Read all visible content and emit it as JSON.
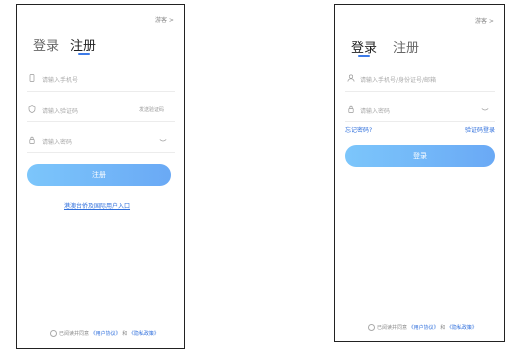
{
  "register_screen": {
    "guest_link": "游客 >",
    "tab_login": "登录",
    "tab_register": "注册",
    "phone_placeholder": "请输入手机号",
    "code_placeholder": "请输入验证码",
    "get_code_label": "发送验证码",
    "password_placeholder": "请输入密码",
    "submit_label": "注册",
    "hmt_link": "港澳台侨及国际用户入口",
    "agree_prefix": "已阅读并同意",
    "user_agreement": "《用户协议》",
    "agree_and": "和",
    "privacy_policy": "《隐私政策》"
  },
  "login_screen": {
    "guest_link": "游客 >",
    "tab_login": "登录",
    "tab_register": "注册",
    "account_placeholder": "请输入手机号/身份证号/邮箱",
    "password_placeholder": "请输入密码",
    "forgot_password": "忘记密码?",
    "sms_login": "验证码登录",
    "submit_label": "登录",
    "agree_prefix": "已阅读并同意",
    "user_agreement": "《用户协议》",
    "agree_and": "和",
    "privacy_policy": "《隐私政策》"
  },
  "icons": [
    "phone-icon",
    "shield-icon",
    "lock-icon",
    "eye-closed-icon",
    "user-icon"
  ],
  "colors": {
    "accent": "#3d7be8",
    "button_from": "#7cc6fb",
    "button_to": "#6aa9f5",
    "link": "#2f6fdc"
  }
}
